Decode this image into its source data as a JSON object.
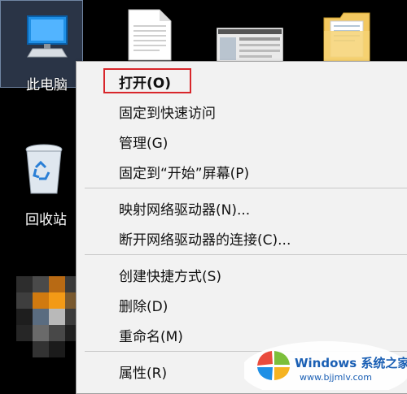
{
  "desktop": {
    "this_pc_label": "此电脑",
    "recycle_bin_label": "回收站"
  },
  "context_menu": {
    "items": [
      {
        "label": "打开(O)",
        "bold": true
      },
      {
        "label": "固定到快速访问"
      },
      {
        "label": "管理(G)"
      },
      {
        "label": "固定到“开始”屏幕(P)"
      },
      {
        "label": "映射网络驱动器(N)..."
      },
      {
        "label": "断开网络驱动器的连接(C)..."
      },
      {
        "label": "创建快捷方式(S)"
      },
      {
        "label": "删除(D)"
      },
      {
        "label": "重命名(M)"
      },
      {
        "label": "属性(R)"
      }
    ]
  },
  "watermark": {
    "brand": "Windows 系统之家",
    "url": "www.bjjmlv.com"
  },
  "colors": {
    "highlight_border": "#d8262b",
    "menu_bg": "#f2f2f2",
    "watermark_blue": "#1a5fb4"
  }
}
